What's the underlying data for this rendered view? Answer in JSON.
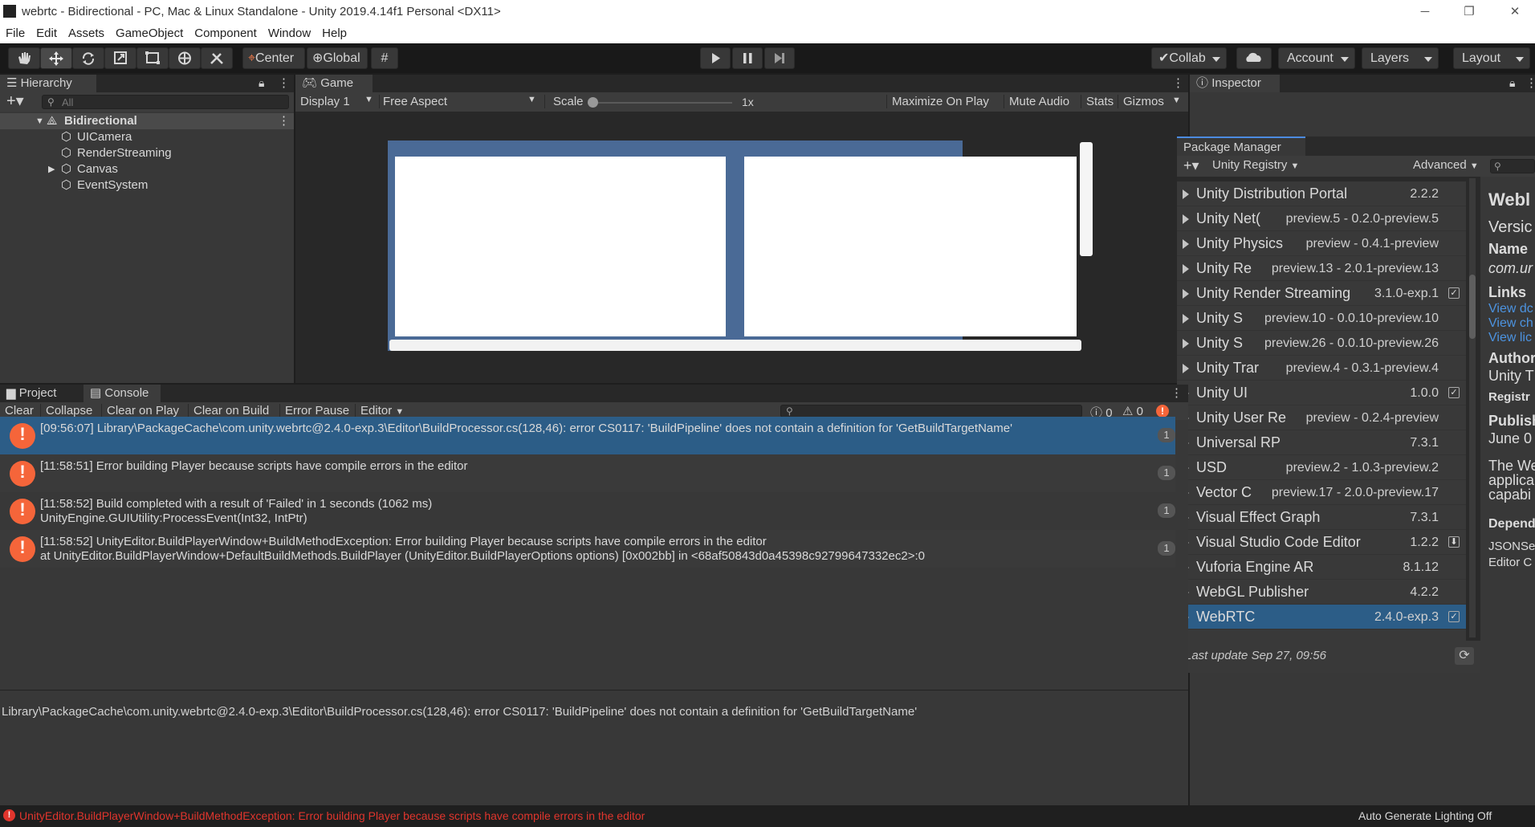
{
  "window": {
    "title": "webrtc - Bidirectional - PC, Mac & Linux Standalone - Unity 2019.4.14f1 Personal <DX11>",
    "minimize": "─",
    "maximize": "❐",
    "close": "✕"
  },
  "menu": [
    "File",
    "Edit",
    "Assets",
    "GameObject",
    "Component",
    "Window",
    "Help"
  ],
  "toolbar": {
    "center": "Center",
    "global": "Global",
    "collab": "Collab",
    "account": "Account",
    "layers": "Layers",
    "layout": "Layout"
  },
  "hierarchy": {
    "tab": "Hierarchy",
    "search_placeholder": "All",
    "scene": "Bidirectional",
    "items": [
      "UICamera",
      "RenderStreaming",
      "Canvas",
      "EventSystem"
    ]
  },
  "game": {
    "tab": "Game",
    "display": "Display 1",
    "aspect": "Free Aspect",
    "scale_label": "Scale",
    "scale_value": 0.0,
    "scale_text": "1x",
    "maximize": "Maximize On Play",
    "mute": "Mute Audio",
    "stats": "Stats",
    "gizmos": "Gizmos"
  },
  "console": {
    "project_tab": "Project",
    "console_tab": "Console",
    "clear": "Clear",
    "collapse": "Collapse",
    "clear_on_play": "Clear on Play",
    "clear_on_build": "Clear on Build",
    "error_pause": "Error Pause",
    "editor": "Editor",
    "info_count": "0",
    "warn_count": "0",
    "entries": [
      {
        "line1": "[09:56:07] Library\\PackageCache\\com.unity.webrtc@2.4.0-exp.3\\Editor\\BuildProcessor.cs(128,46): error CS0117: 'BuildPipeline' does not contain a definition for 'GetBuildTargetName'",
        "line2": "",
        "count": "1"
      },
      {
        "line1": "[11:58:51] Error building Player because scripts have compile errors in the editor",
        "line2": "",
        "count": "1"
      },
      {
        "line1": "[11:58:52] Build completed with a result of 'Failed' in 1 seconds (1062 ms)",
        "line2": "UnityEngine.GUIUtility:ProcessEvent(Int32, IntPtr)",
        "count": "1"
      },
      {
        "line1": "[11:58:52] UnityEditor.BuildPlayerWindow+BuildMethodException: Error building Player because scripts have compile errors in the editor",
        "line2": "  at UnityEditor.BuildPlayerWindow+DefaultBuildMethods.BuildPlayer (UnityEditor.BuildPlayerOptions options) [0x002bb] in <68af50843d0a45398c92799647332ec2>:0",
        "count": "1"
      }
    ],
    "detail": "Library\\PackageCache\\com.unity.webrtc@2.4.0-exp.3\\Editor\\BuildProcessor.cs(128,46): error CS0117: 'BuildPipeline' does not contain a definition for 'GetBuildTargetName'"
  },
  "inspector": {
    "tab": "Inspector"
  },
  "package_manager": {
    "title": "Package Manager",
    "registry": "Unity Registry",
    "advanced": "Advanced",
    "last_update": "Last update Sep 27, 09:56",
    "packages": [
      {
        "name": "Unity Distribution Portal",
        "version": "2.2.2",
        "status": ""
      },
      {
        "name": "Unity Net(",
        "version": "preview.5 - 0.2.0-preview.5",
        "status": ""
      },
      {
        "name": "Unity Physics",
        "version": "preview - 0.4.1-preview",
        "status": ""
      },
      {
        "name": "Unity Re",
        "version": "preview.13 - 2.0.1-preview.13",
        "status": ""
      },
      {
        "name": "Unity Render Streaming",
        "version": "3.1.0-exp.1",
        "status": "✓"
      },
      {
        "name": "Unity S",
        "version": "preview.10 - 0.0.10-preview.10",
        "status": ""
      },
      {
        "name": "Unity S",
        "version": "preview.26 - 0.0.10-preview.26",
        "status": ""
      },
      {
        "name": "Unity Trar",
        "version": "preview.4 - 0.3.1-preview.4",
        "status": ""
      },
      {
        "name": "Unity UI",
        "version": "1.0.0",
        "status": "✓"
      },
      {
        "name": "Unity User Re",
        "version": "preview - 0.2.4-preview",
        "status": ""
      },
      {
        "name": "Universal RP",
        "version": "7.3.1",
        "status": ""
      },
      {
        "name": "USD",
        "version": "preview.2 - 1.0.3-preview.2",
        "status": ""
      },
      {
        "name": "Vector C",
        "version": "preview.17 - 2.0.0-preview.17",
        "status": ""
      },
      {
        "name": "Visual Effect Graph",
        "version": "7.3.1",
        "status": ""
      },
      {
        "name": "Visual Studio Code Editor",
        "version": "1.2.2",
        "status": "⬇"
      },
      {
        "name": "Vuforia Engine AR",
        "version": "8.1.12",
        "status": ""
      },
      {
        "name": "WebGL Publisher",
        "version": "4.2.2",
        "status": ""
      },
      {
        "name": "WebRTC",
        "version": "2.4.0-exp.3",
        "status": "✓"
      }
    ],
    "detail": {
      "title": "Webl",
      "version": "Versic",
      "name_label": "Name",
      "name_value": "com.ur",
      "links_label": "Links",
      "link1": "View dc",
      "link2": "View ch",
      "link3": "View lic",
      "author_label": "Author",
      "author_value": "Unity T",
      "registry_label": "Registr",
      "published_label": "Publish",
      "published_value": "June 0",
      "desc1": "The We",
      "desc2": "applica",
      "desc3": "capabi",
      "deps_label": "Depend",
      "dep1": "JSONSe",
      "dep2": "Editor C"
    }
  },
  "status": {
    "error": "UnityEditor.BuildPlayerWindow+BuildMethodException: Error building Player because scripts have compile errors in the editor",
    "lighting": "Auto Generate Lighting Off"
  },
  "colors": {
    "selection": "#2c5d87",
    "error": "#f5653a",
    "status_error": "#e0352d",
    "game_bg": "#4a6a96"
  }
}
